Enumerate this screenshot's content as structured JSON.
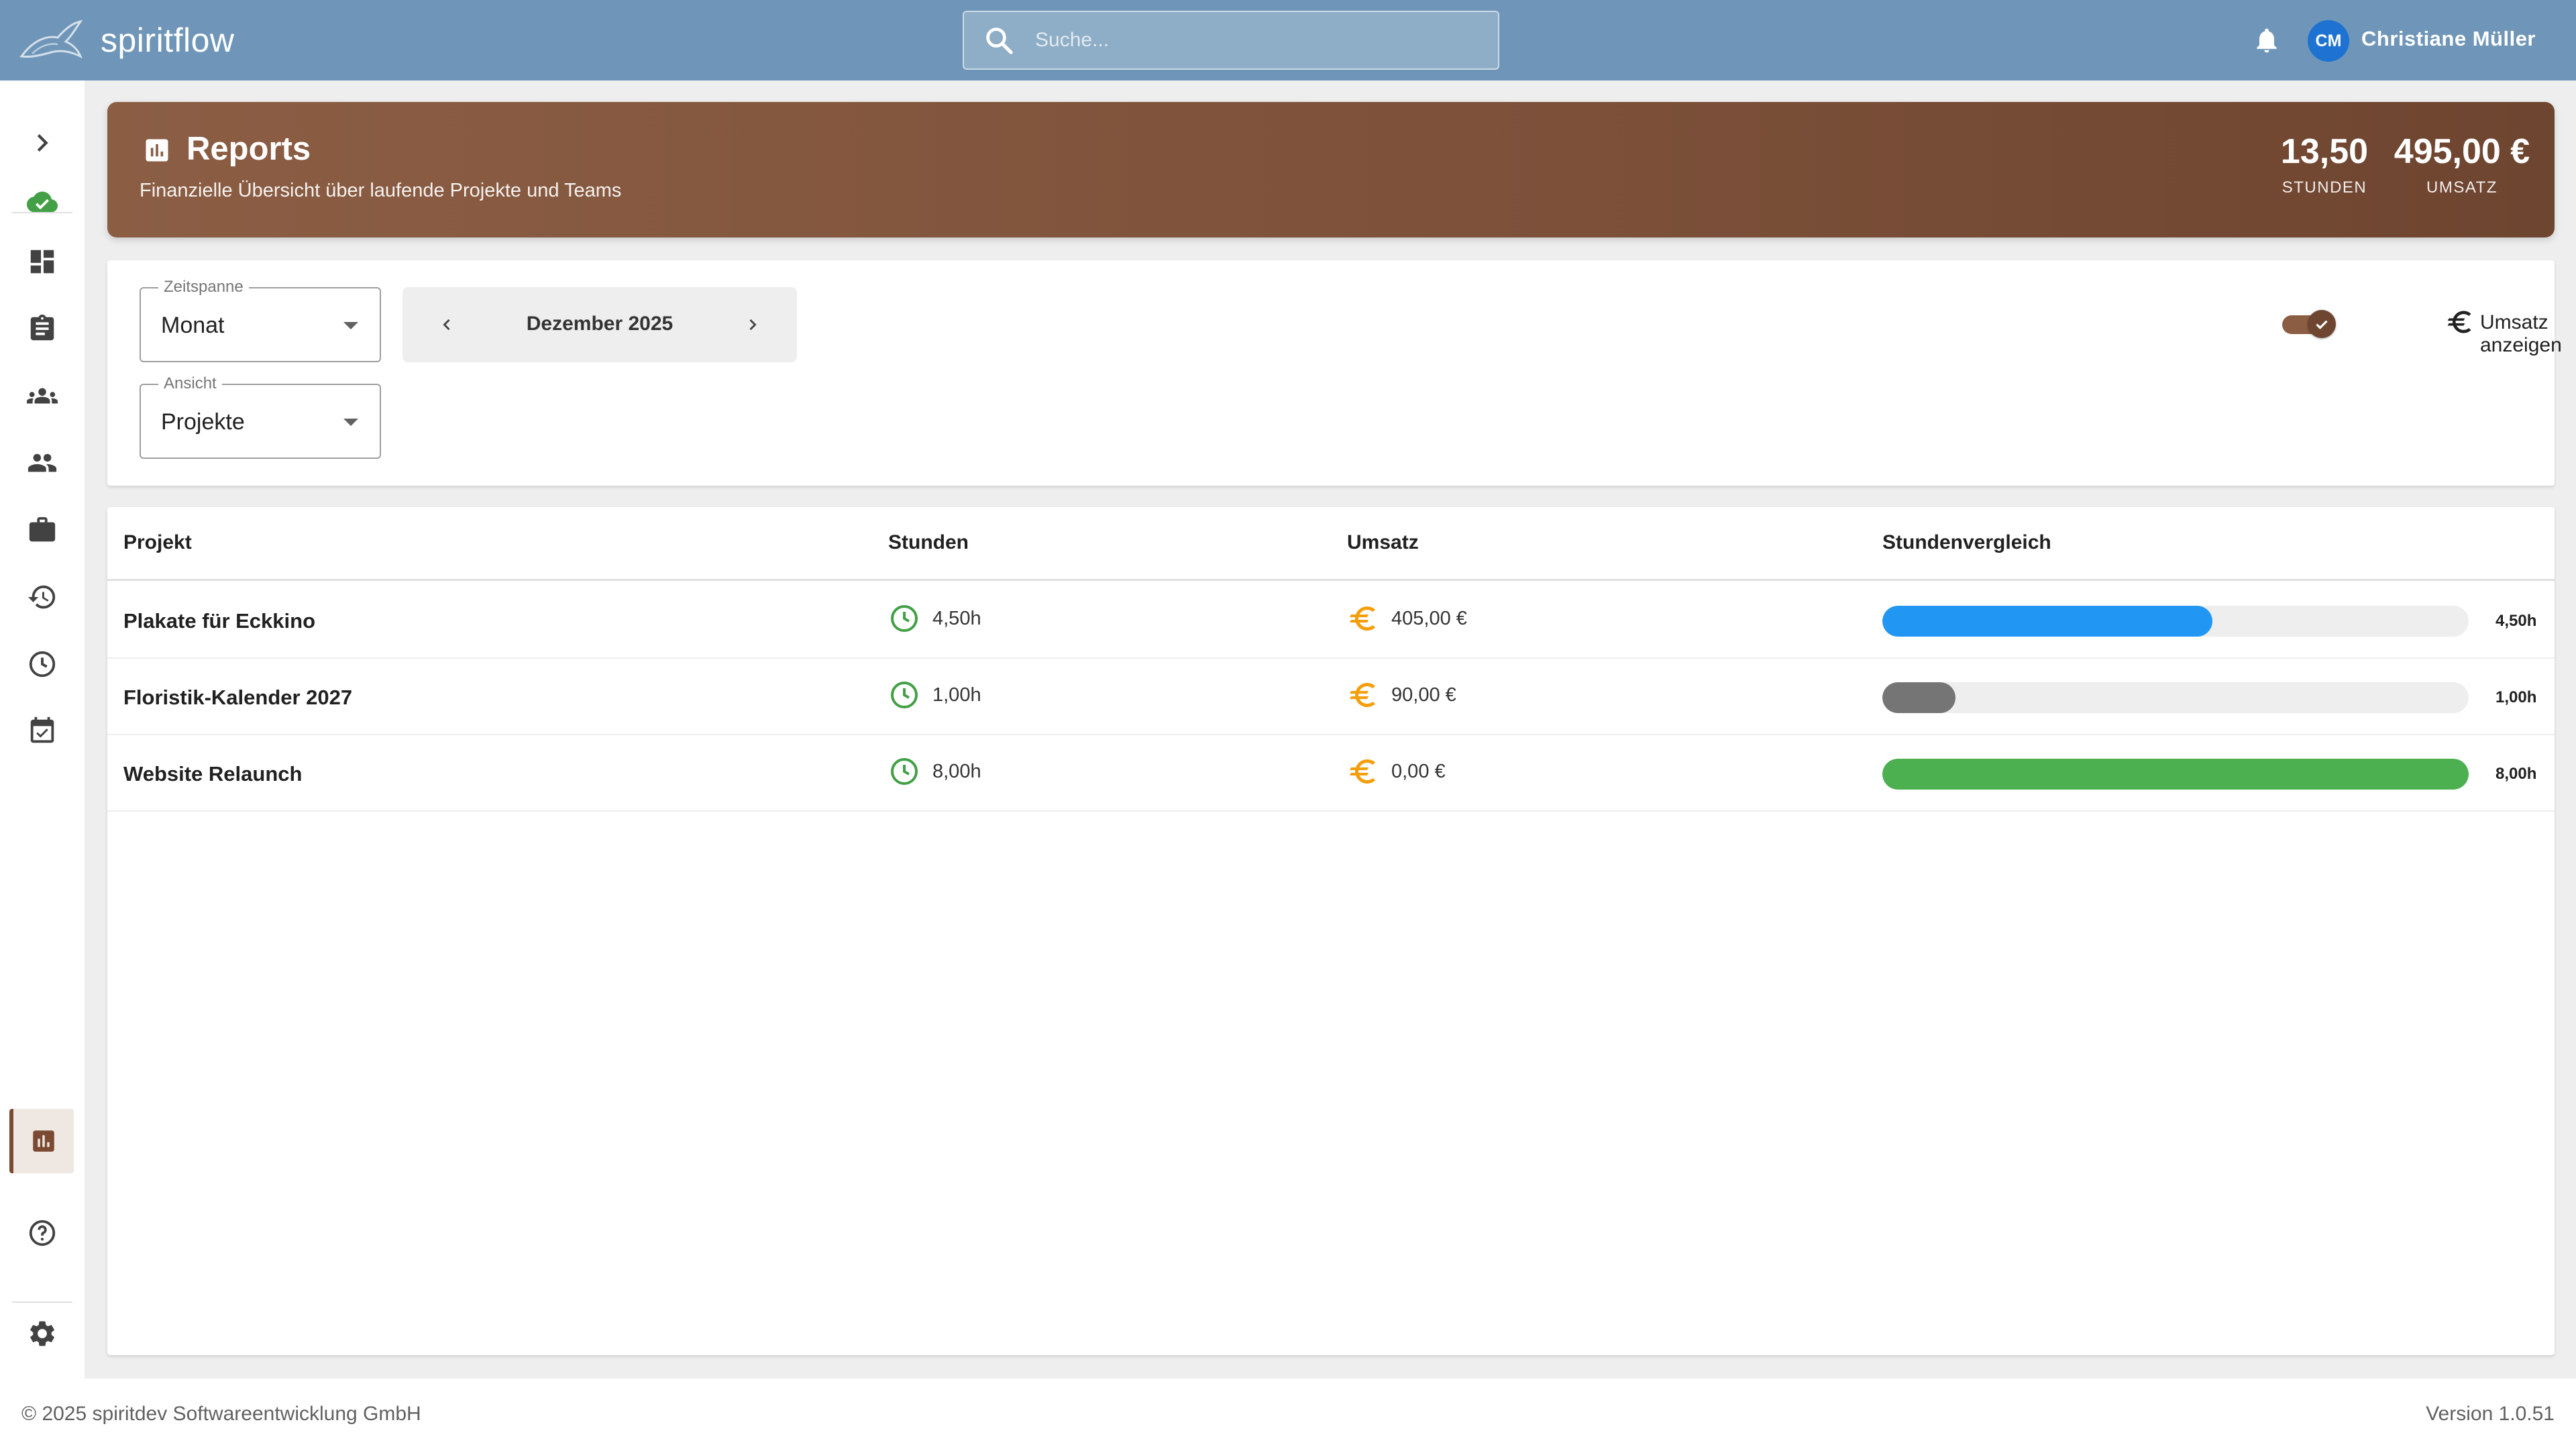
{
  "app": {
    "brand": "spiritflow"
  },
  "search": {
    "placeholder": "Suche..."
  },
  "user": {
    "initials": "CM",
    "name": "Christiane Müller"
  },
  "header": {
    "title": "Reports",
    "subtitle": "Finanzielle Übersicht über laufende Projekte und Teams",
    "stats": [
      {
        "value": "13,50",
        "label": "STUNDEN"
      },
      {
        "value": "495,00 €",
        "label": "UMSATZ"
      }
    ]
  },
  "filters": {
    "zeitspanne": {
      "label": "Zeitspanne",
      "value": "Monat"
    },
    "ansicht": {
      "label": "Ansicht",
      "value": "Projekte"
    },
    "period": "Dezember 2025",
    "toggle": {
      "label": "Umsatz anzeigen",
      "checked": true
    }
  },
  "table": {
    "columns": [
      "Projekt",
      "Stunden",
      "Umsatz",
      "Stundenvergleich"
    ],
    "rows": [
      {
        "project": "Plakate für Eckkino",
        "hours": "4,50h",
        "revenue": "405,00 €",
        "bar_label": "4,50h",
        "bar_fraction": 0.5625,
        "bar_color": "#2196f3"
      },
      {
        "project": "Floristik-Kalender 2027",
        "hours": "1,00h",
        "revenue": "90,00 €",
        "bar_label": "1,00h",
        "bar_fraction": 0.125,
        "bar_color": "#757575"
      },
      {
        "project": "Website Relaunch",
        "hours": "8,00h",
        "revenue": "0,00 €",
        "bar_label": "8,00h",
        "bar_fraction": 1.0,
        "bar_color": "#4caf50"
      }
    ]
  },
  "sidebar": {
    "icons": [
      "chevron-right-icon",
      "cloud-check-icon",
      "dashboard-icon",
      "clipboard-icon",
      "groups-icon",
      "people-icon",
      "briefcase-icon",
      "history-icon",
      "clock-icon",
      "calendar-check-icon",
      "bar-chart-icon",
      "help-icon",
      "gear-icon"
    ]
  },
  "colors": {
    "topbar": "#6f96b8",
    "accent_brown": "#7c5039",
    "clock_green": "#43a047",
    "euro_orange": "#f59e0b"
  },
  "footer": {
    "copyright": "© 2025 spiritdev Softwareentwicklung GmbH",
    "version": "Version 1.0.51"
  }
}
